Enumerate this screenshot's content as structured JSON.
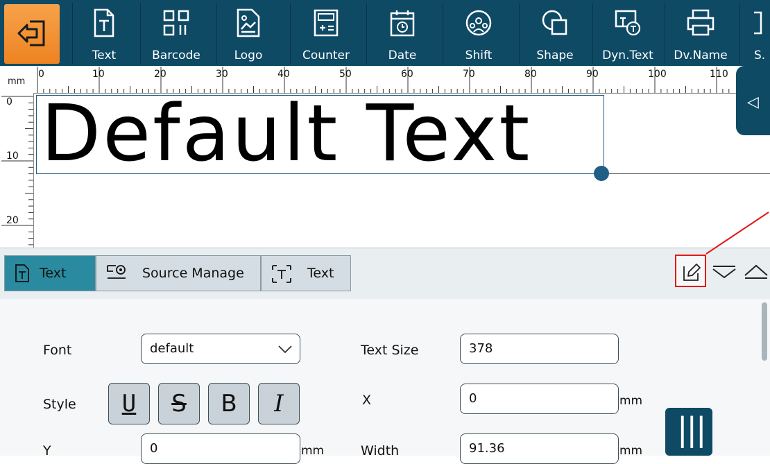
{
  "toolbar": {
    "items": [
      {
        "label": "Text",
        "icon": "text-doc-icon"
      },
      {
        "label": "Barcode",
        "icon": "barcode-icon"
      },
      {
        "label": "Logo",
        "icon": "logo-icon"
      },
      {
        "label": "Counter",
        "icon": "counter-icon"
      },
      {
        "label": "Date",
        "icon": "calendar-icon"
      },
      {
        "label": "Shift",
        "icon": "shift-icon"
      },
      {
        "label": "Shape",
        "icon": "shape-icon"
      },
      {
        "label": "Dyn.Text",
        "icon": "dyn-text-icon"
      },
      {
        "label": "Dv.Name",
        "icon": "printer-icon"
      },
      {
        "label": "S.",
        "icon": "serial-icon"
      }
    ],
    "colors": {
      "bar": "#0f4a65",
      "exit": "#ee8322"
    }
  },
  "ruler": {
    "unit": "mm",
    "top_labels": [
      "0",
      "10",
      "20",
      "30",
      "40",
      "50",
      "60",
      "70",
      "80",
      "90",
      "100",
      "110"
    ],
    "left_labels": [
      "0",
      "10",
      "20"
    ]
  },
  "canvas": {
    "text": "Default Text"
  },
  "tabs": [
    {
      "label": "Text",
      "active": true
    },
    {
      "label": "Source Manage",
      "active": false
    },
    {
      "label": "Text",
      "active": false
    }
  ],
  "form": {
    "font_label": "Font",
    "font_value": "default",
    "text_size_label": "Text Size",
    "text_size_value": "378",
    "style_label": "Style",
    "style_buttons": [
      "U",
      "S",
      "B",
      "I"
    ],
    "x_label": "X",
    "x_value": "0",
    "y_label": "Y",
    "y_value": "0",
    "width_label": "Width",
    "width_value": "91.36",
    "unit": "mm"
  },
  "colors": {
    "accent": "#2a8ba0",
    "highlight": "#e01a1a"
  }
}
